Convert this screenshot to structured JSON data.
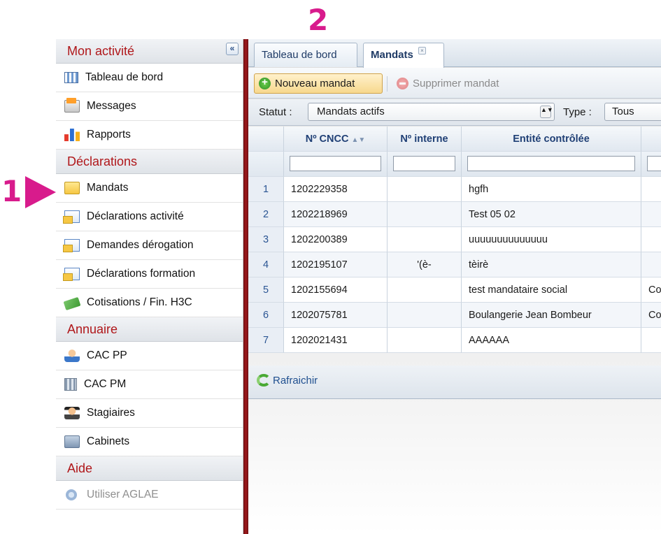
{
  "callouts": {
    "step1": "1",
    "step2": "2"
  },
  "sidebar": {
    "collapse_label": "«",
    "sections": [
      {
        "title": "Mon activité",
        "items": [
          {
            "label": "Tableau de bord",
            "icon": "dashboard-icon"
          },
          {
            "label": "Messages",
            "icon": "messages-icon"
          },
          {
            "label": "Rapports",
            "icon": "chart-icon"
          }
        ]
      },
      {
        "title": "Déclarations",
        "items": [
          {
            "label": "Mandats",
            "icon": "folder-icon"
          },
          {
            "label": "Déclarations activité",
            "icon": "document-icon"
          },
          {
            "label": "Demandes dérogation",
            "icon": "document-icon"
          },
          {
            "label": "Déclarations formation",
            "icon": "document-icon"
          },
          {
            "label": "Cotisations / Fin. H3C",
            "icon": "money-icon"
          }
        ]
      },
      {
        "title": "Annuaire",
        "items": [
          {
            "label": "CAC PP",
            "icon": "user-icon"
          },
          {
            "label": "CAC PM",
            "icon": "building-icon"
          },
          {
            "label": "Stagiaires",
            "icon": "trainee-icon"
          },
          {
            "label": "Cabinets",
            "icon": "cabinet-icon"
          }
        ]
      },
      {
        "title": "Aide",
        "items": [
          {
            "label": "Utiliser AGLAE",
            "icon": "help-icon"
          }
        ]
      }
    ]
  },
  "tabs": {
    "dashboard": "Tableau de bord",
    "mandats": "Mandats",
    "close": "×"
  },
  "toolbar": {
    "new_label": "Nouveau mandat",
    "delete_label": "Supprimer mandat"
  },
  "filters": {
    "statut_label": "Statut :",
    "statut_value": "Mandats actifs",
    "type_label": "Type :",
    "type_value": "Tous",
    "select_arrows": "▲▼"
  },
  "grid": {
    "columns": {
      "cncc": "Nº CNCC",
      "interne": "Nº interne",
      "entite": "Entité contrôlée",
      "sort": "▲▼"
    },
    "rows": [
      {
        "n": "1",
        "cncc": "1202229358",
        "interne": "",
        "entite": "hgfh",
        "extra": ""
      },
      {
        "n": "2",
        "cncc": "1202218969",
        "interne": "",
        "entite": "Test 05 02",
        "extra": ""
      },
      {
        "n": "3",
        "cncc": "1202200389",
        "interne": "",
        "entite": "uuuuuuuuuuuuuu",
        "extra": ""
      },
      {
        "n": "4",
        "cncc": "1202195107",
        "interne": "'(è-",
        "entite": "tèirè",
        "extra": ""
      },
      {
        "n": "5",
        "cncc": "1202155694",
        "interne": "",
        "entite": "test mandataire social",
        "extra": "Co"
      },
      {
        "n": "6",
        "cncc": "1202075781",
        "interne": "",
        "entite": "Boulangerie Jean Bombeur",
        "extra": "Co"
      },
      {
        "n": "7",
        "cncc": "1202021431",
        "interne": "",
        "entite": "AAAAAA",
        "extra": ""
      }
    ]
  },
  "footer": {
    "refresh_label": "Rafraichir"
  },
  "colors": {
    "accent": "#d81b8c",
    "section_title": "#b0171a",
    "divider": "#a01a1d"
  }
}
